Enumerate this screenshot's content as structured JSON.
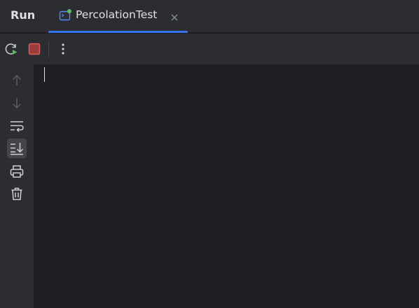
{
  "panel": {
    "title": "Run"
  },
  "tab": {
    "label": "PercolationTest",
    "icon": "run-config-icon",
    "close_icon": "close-icon"
  },
  "toolbar": {
    "buttons": [
      {
        "name": "rerun",
        "icon": "rerun-icon"
      },
      {
        "name": "stop",
        "icon": "stop-icon"
      },
      {
        "name": "more",
        "icon": "more-vertical-icon"
      }
    ]
  },
  "gutter": {
    "buttons": [
      {
        "name": "previous-occurrence",
        "icon": "arrow-up-icon"
      },
      {
        "name": "next-occurrence",
        "icon": "arrow-down-icon"
      },
      {
        "name": "soft-wrap",
        "icon": "soft-wrap-icon"
      },
      {
        "name": "scroll-to-end",
        "icon": "scroll-to-end-icon",
        "active": true
      },
      {
        "name": "print",
        "icon": "print-icon"
      },
      {
        "name": "clear-all",
        "icon": "trash-icon"
      }
    ]
  },
  "console": {
    "output": ""
  },
  "colors": {
    "background": "#1e1f22",
    "panel": "#2b2d30",
    "accent": "#3574f0",
    "text": "#dfe1e5",
    "stop_red": "#db5c5c",
    "run_green": "#5fb865"
  }
}
